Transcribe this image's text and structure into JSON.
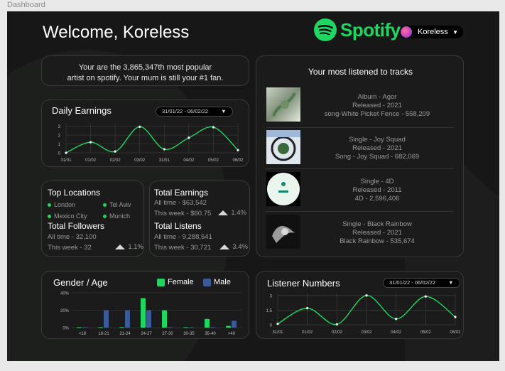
{
  "frame_label": "Dashboard",
  "header": {
    "welcome": "Welcome, Koreless",
    "logo_text": "Spotify",
    "user_name": "Koreless"
  },
  "colors": {
    "accent": "#1ed760",
    "female": "#1ed760",
    "male": "#3a5a9a",
    "background": "#171717"
  },
  "popularity_message": {
    "line1": "Your are the 3,865,347th most popular",
    "line2": "artist on spotify.  Your mum is still your #1 fan."
  },
  "daily_earnings": {
    "title": "Daily Earnings",
    "date_from": "31/01/22",
    "separator": "-",
    "date_to": "06/02/22"
  },
  "locations": {
    "title": "Top Locations",
    "items": [
      "London",
      "Tel Aviv",
      "Mexico City",
      "Munich"
    ]
  },
  "followers": {
    "title": "Total Followers",
    "all_time": "All time - 32,100",
    "this_week": "This week - 32",
    "change": "1.1%"
  },
  "earnings": {
    "title": "Total Earnings",
    "all_time": "All time - $63,542",
    "this_week": "This week - $60.75",
    "change": "1.4%"
  },
  "listens": {
    "title": "Total Listens",
    "all_time": "All time - 9,288,541",
    "this_week": "This week - 30,721",
    "change": "3.4%"
  },
  "tracks": {
    "title": "Your most listened to tracks",
    "items": [
      {
        "line1": "Album - Agor",
        "line2": "Released - 2021",
        "line3": "song-White Picket Fence - 558,209"
      },
      {
        "line1": "Single - Joy Squad",
        "line2": "Released - 2021",
        "line3": "Song - Joy Squad - 682,069"
      },
      {
        "line1": "Single - 4D",
        "line2": "Released - 2011",
        "line3": "4D - 2,596,406"
      },
      {
        "line1": "Single - Black Rainbow",
        "line2": "Released - 2021",
        "line3": "Black Rainbow - 535,674"
      }
    ]
  },
  "gender_age": {
    "title": "Gender / Age",
    "legend_female": "Female",
    "legend_male": "Male"
  },
  "listener_numbers": {
    "title": "Listener Numbers",
    "date_from": "31/01/22",
    "separator": "-",
    "date_to": "06/02/22"
  },
  "chart_data": [
    {
      "type": "line",
      "title": "Daily Earnings",
      "x": [
        "31/01",
        "01/02",
        "02/02",
        "03/02",
        "31/01",
        "04/02",
        "05/02",
        "06/02"
      ],
      "y": [
        0.0,
        1.2,
        0.15,
        2.95,
        0.4,
        1.7,
        2.9,
        0.3
      ],
      "yticks": [
        0,
        1,
        2,
        3
      ],
      "ylim": [
        0,
        3.3
      ],
      "grid": true
    },
    {
      "type": "bar",
      "title": "Gender / Age",
      "categories": [
        "<18",
        "18-21",
        "21-24",
        "24-27",
        "27-30",
        "30-35",
        "35-40",
        ">40"
      ],
      "series": [
        {
          "name": "Female",
          "values": [
            0.5,
            0.5,
            0.5,
            34,
            20,
            0.5,
            10,
            2
          ]
        },
        {
          "name": "Male",
          "values": [
            0.5,
            20,
            20,
            20,
            0.5,
            0.5,
            0.5,
            8
          ]
        }
      ],
      "yticks": [
        "0%",
        "20%",
        "40%"
      ],
      "ylim": [
        0,
        40
      ]
    },
    {
      "type": "line",
      "title": "Listener Numbers",
      "x": [
        "31/01",
        "01/02",
        "02/02",
        "03/02",
        "04/02",
        "05/02",
        "06/02"
      ],
      "y": [
        0.1,
        1.7,
        0.05,
        3.0,
        0.6,
        2.9,
        0.8
      ],
      "yticks": [
        0,
        1.5,
        3
      ],
      "ylim": [
        0,
        3.2
      ],
      "grid": true
    }
  ]
}
